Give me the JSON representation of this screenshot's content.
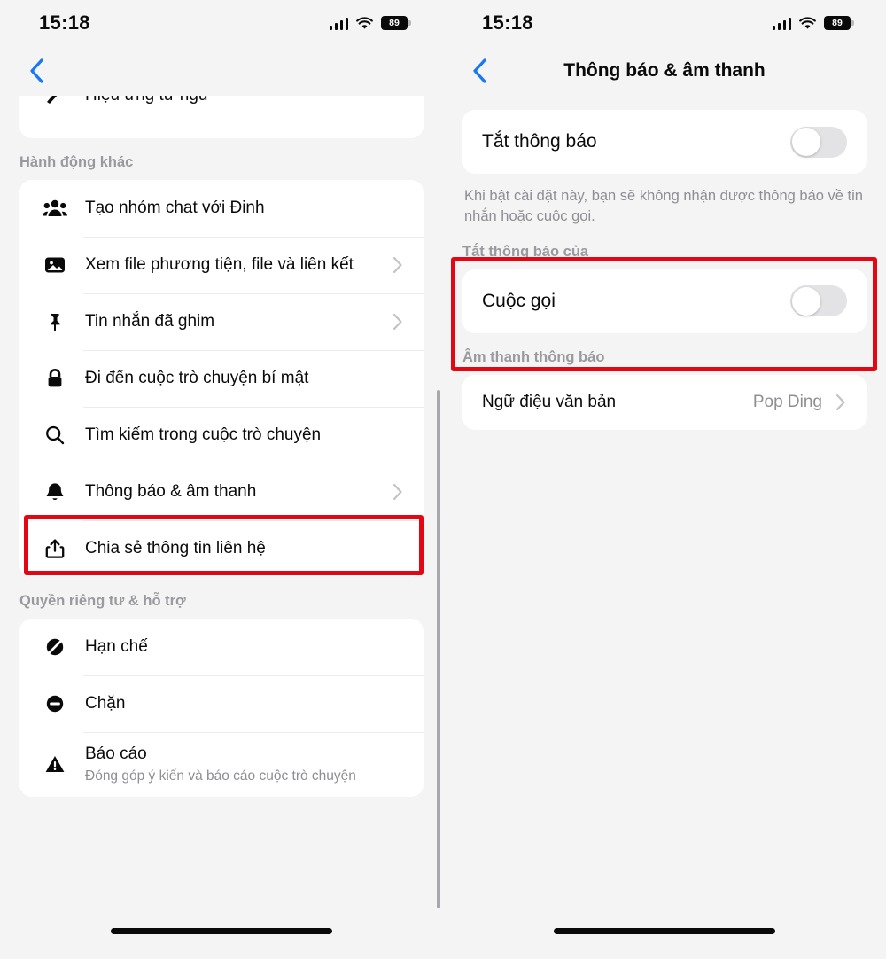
{
  "status_bar": {
    "time": "15:18",
    "battery_level": "89",
    "signal_icon": "cellular-signal-icon",
    "wifi_icon": "wifi-icon",
    "battery_icon": "battery-icon"
  },
  "colors": {
    "accent_blue": "#1877f2",
    "highlight_red": "#e30613",
    "background": "#f4f4f5",
    "card": "#ffffff",
    "muted_text": "#8e8e93"
  },
  "left_panel": {
    "back_label": "Back",
    "clipped_row": {
      "label": "Hiệu ứng từ ngữ",
      "icon": "word-effect-icon"
    },
    "sections": [
      {
        "header": "Hành động khác",
        "items": [
          {
            "label": "Tạo nhóm chat với Đinh",
            "icon": "people-group-icon",
            "chevron": false
          },
          {
            "label": "Xem file phương tiện, file và liên kết",
            "icon": "photo-icon",
            "chevron": true
          },
          {
            "label": "Tin nhắn đã ghim",
            "icon": "pin-icon",
            "chevron": true
          },
          {
            "label": "Đi đến cuộc trò chuyện bí mật",
            "icon": "lock-icon",
            "chevron": false
          },
          {
            "label": "Tìm kiếm trong cuộc trò chuyện",
            "icon": "search-icon",
            "chevron": false
          },
          {
            "label": "Thông báo & âm thanh",
            "icon": "bell-icon",
            "chevron": true,
            "highlighted": true
          },
          {
            "label": "Chia sẻ thông tin liên hệ",
            "icon": "share-icon",
            "chevron": false
          }
        ]
      },
      {
        "header": "Quyền riêng tư & hỗ trợ",
        "items": [
          {
            "label": "Hạn chế",
            "icon": "restrict-icon",
            "chevron": false
          },
          {
            "label": "Chặn",
            "icon": "block-icon",
            "chevron": false
          },
          {
            "label": "Báo cáo",
            "sublabel": "Đóng góp ý kiến và báo cáo cuộc trò chuyện",
            "icon": "warning-triangle-icon",
            "chevron": false
          }
        ]
      }
    ]
  },
  "right_panel": {
    "title": "Thông báo & âm thanh",
    "back_label": "Back",
    "mute_toggle": {
      "label": "Tắt thông báo",
      "state": "off"
    },
    "help_text": "Khi bật cài đặt này, bạn sẽ không nhận được thông báo về tin nhắn hoặc cuộc gọi.",
    "mute_for": {
      "header": "Tắt thông báo của",
      "items": [
        {
          "label": "Cuộc gọi",
          "state": "off"
        }
      ]
    },
    "sound_section": {
      "header": "Âm thanh thông báo",
      "items": [
        {
          "label": "Ngữ điệu văn bản",
          "value": "Pop Ding",
          "chevron": true
        }
      ]
    }
  }
}
